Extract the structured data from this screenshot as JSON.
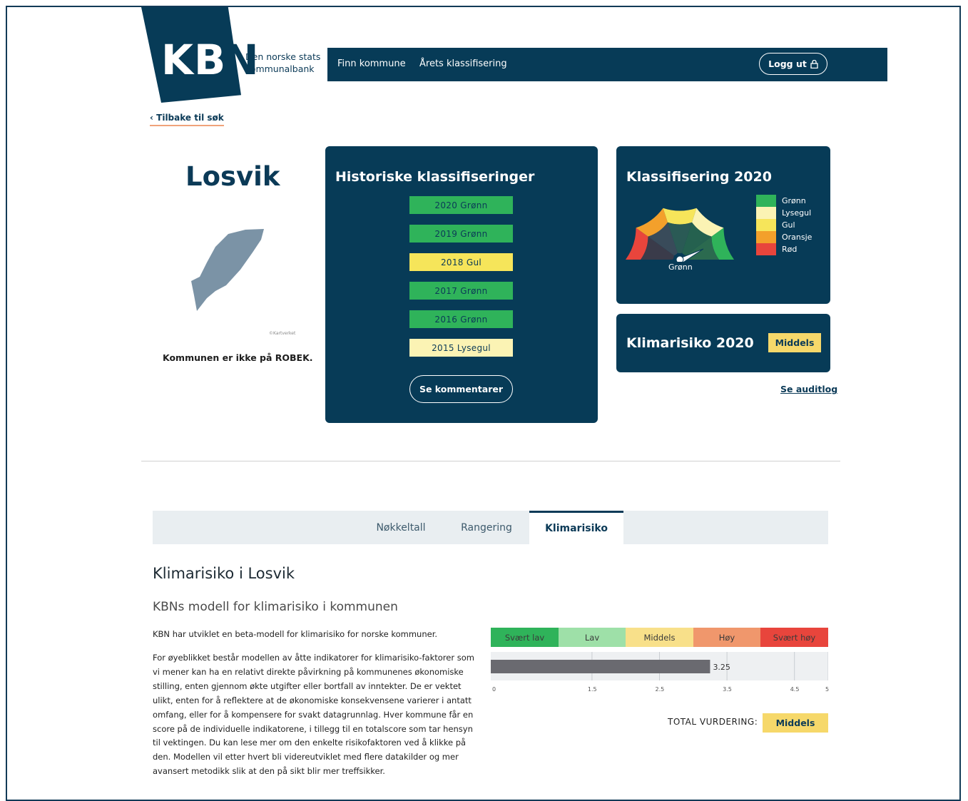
{
  "brand": {
    "logo": "KBN",
    "subtitle": "Den norske stats kommunalbank"
  },
  "nav": {
    "links": [
      "Finn kommune",
      "Årets klassifisering"
    ],
    "logout_label": "Logg ut",
    "logout_icon": "lock-icon"
  },
  "back_link": "Tilbake til søk",
  "municipality": {
    "name": "Losvik",
    "map_credit": "©Kartverket",
    "robek_status": "Kommunen er ikke på ROBEK."
  },
  "history": {
    "title": "Historiske klassifiseringer",
    "items": [
      {
        "label": "2020 Grønn",
        "color": "#2fb35a"
      },
      {
        "label": "2019 Grønn",
        "color": "#2fb35a"
      },
      {
        "label": "2018 Gul",
        "color": "#f6e55a"
      },
      {
        "label": "2017 Grønn",
        "color": "#2fb35a"
      },
      {
        "label": "2016 Grønn",
        "color": "#2fb35a"
      },
      {
        "label": "2015 Lysegul",
        "color": "#fbf3b4"
      }
    ],
    "comments_button": "Se kommentarer"
  },
  "classification": {
    "title": "Klassifisering 2020",
    "current": "Grønn",
    "legend": [
      {
        "label": "Grønn",
        "color": "#2fb35a"
      },
      {
        "label": "Lysegul",
        "color": "#fbf3b4"
      },
      {
        "label": "Gul",
        "color": "#f6e55a"
      },
      {
        "label": "Oransje",
        "color": "#f3a02b"
      },
      {
        "label": "Rød",
        "color": "#e8453c"
      }
    ]
  },
  "climate": {
    "title": "Klimarisiko 2020",
    "badge": "Middels"
  },
  "audit_link": "Se auditlog",
  "tabs": [
    {
      "label": "Nøkkeltall",
      "active": false
    },
    {
      "label": "Rangering",
      "active": false
    },
    {
      "label": "Klimarisiko",
      "active": true
    }
  ],
  "section": {
    "title": "Klimarisiko i Losvik",
    "subtitle": "KBNs modell for klimarisiko i kommunen",
    "intro": "KBN har utviklet en beta-modell for klimarisiko for norske kommuner.",
    "body": "For øyeblikket består modellen av åtte indikatorer for klimarisiko-faktorer som vi mener kan ha en relativt direkte påvirkning på kommunenes økonomiske stilling, enten gjennom økte utgifter eller bortfall av inntekter. De er vektet ulikt, enten for å reflektere at de økonomiske konsekvensene varierer i antatt omfang, eller for å kompensere for svakt datagrunnlag. Hver kommune får en score på de individuelle indikatorene, i tillegg til en totalscore som tar hensyn til vektingen. Du kan lese mer om den enkelte risikofaktoren ved å klikke på den. Modellen vil etter hvert bli videreutviklet med flere datakilder og mer avansert metodikk slik at den på sikt blir mer treffsikker."
  },
  "risk_scale": [
    {
      "label": "Svært lav",
      "color": "#2fb35a"
    },
    {
      "label": "Lav",
      "color": "#9ee0a8"
    },
    {
      "label": "Middels",
      "color": "#f8e08a"
    },
    {
      "label": "Høy",
      "color": "#f0976c"
    },
    {
      "label": "Svært høy",
      "color": "#e8453c"
    }
  ],
  "total": {
    "label": "TOTAL VURDERING:",
    "value": "Middels"
  },
  "chart_data": {
    "type": "bar",
    "orientation": "horizontal",
    "values": [
      3.25
    ],
    "data_labels": [
      "3.25"
    ],
    "x_ticks": [
      0,
      1.5,
      2.5,
      3.5,
      4.5,
      5
    ],
    "x_tick_labels": [
      "0",
      "1.5",
      "2.5",
      "3.5",
      "4.5",
      "5"
    ],
    "xlim": [
      0,
      5
    ],
    "bar_color": "#6a6a70",
    "grid": true
  }
}
